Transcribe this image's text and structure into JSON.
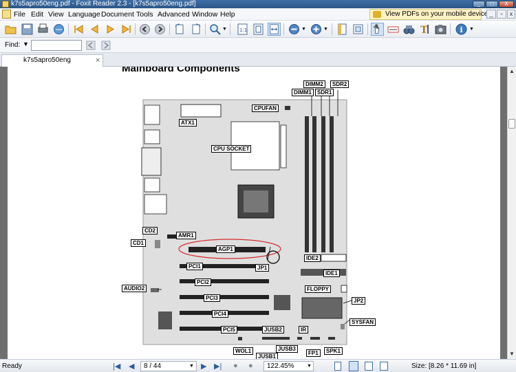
{
  "window": {
    "title": "k7s5apro50eng.pdf - Foxit Reader 2.3 - [k7s5apro50eng.pdf]",
    "minimize": "_",
    "maximize": "□",
    "close": "X"
  },
  "menu": {
    "items": [
      "File",
      "Edit",
      "View",
      "Language",
      "Document",
      "Tools",
      "Advanced",
      "Window",
      "Help"
    ],
    "promo": "View PDFs on your mobile devices"
  },
  "findbar": {
    "label": "Find:",
    "value": ""
  },
  "tab": {
    "label": "k7s5apro50eng",
    "close": "×"
  },
  "document": {
    "heading": "Mainboard Components",
    "labels": {
      "dimm2": "DIMM2",
      "sdr2": "SDR2",
      "dimm1": "DIMM1",
      "sdr1": "SDR1",
      "cpufan": "CPUFAN",
      "atx1": "ATX1",
      "cpu_socket": "CPU SOCKET",
      "cd2": "CD2",
      "cd1": "CD1",
      "amr1": "AMR1",
      "agp1": "AGP1",
      "jp1": "JP1",
      "pci1": "PCI1",
      "pci2": "PCI2",
      "pci3": "PCI3",
      "pci4": "PCI4",
      "pci5": "PCI5",
      "audio2": "AUDIO2",
      "ide2": "IDE2",
      "ide1": "IDE1",
      "floppy": "FLOPPY",
      "jp2": "JP2",
      "sysfan": "SYSFAN",
      "jusb2": "JUSB2",
      "jusb3": "JUSB3",
      "jusb1": "JUSB1",
      "ir": "IR",
      "wol1": "WOL1",
      "fp1": "FP1",
      "spk1": "SPK1"
    }
  },
  "status": {
    "ready": "Ready",
    "page": "8 / 44",
    "zoom": "122.45%",
    "size": "Size: [8.26 * 11.69 in]"
  }
}
